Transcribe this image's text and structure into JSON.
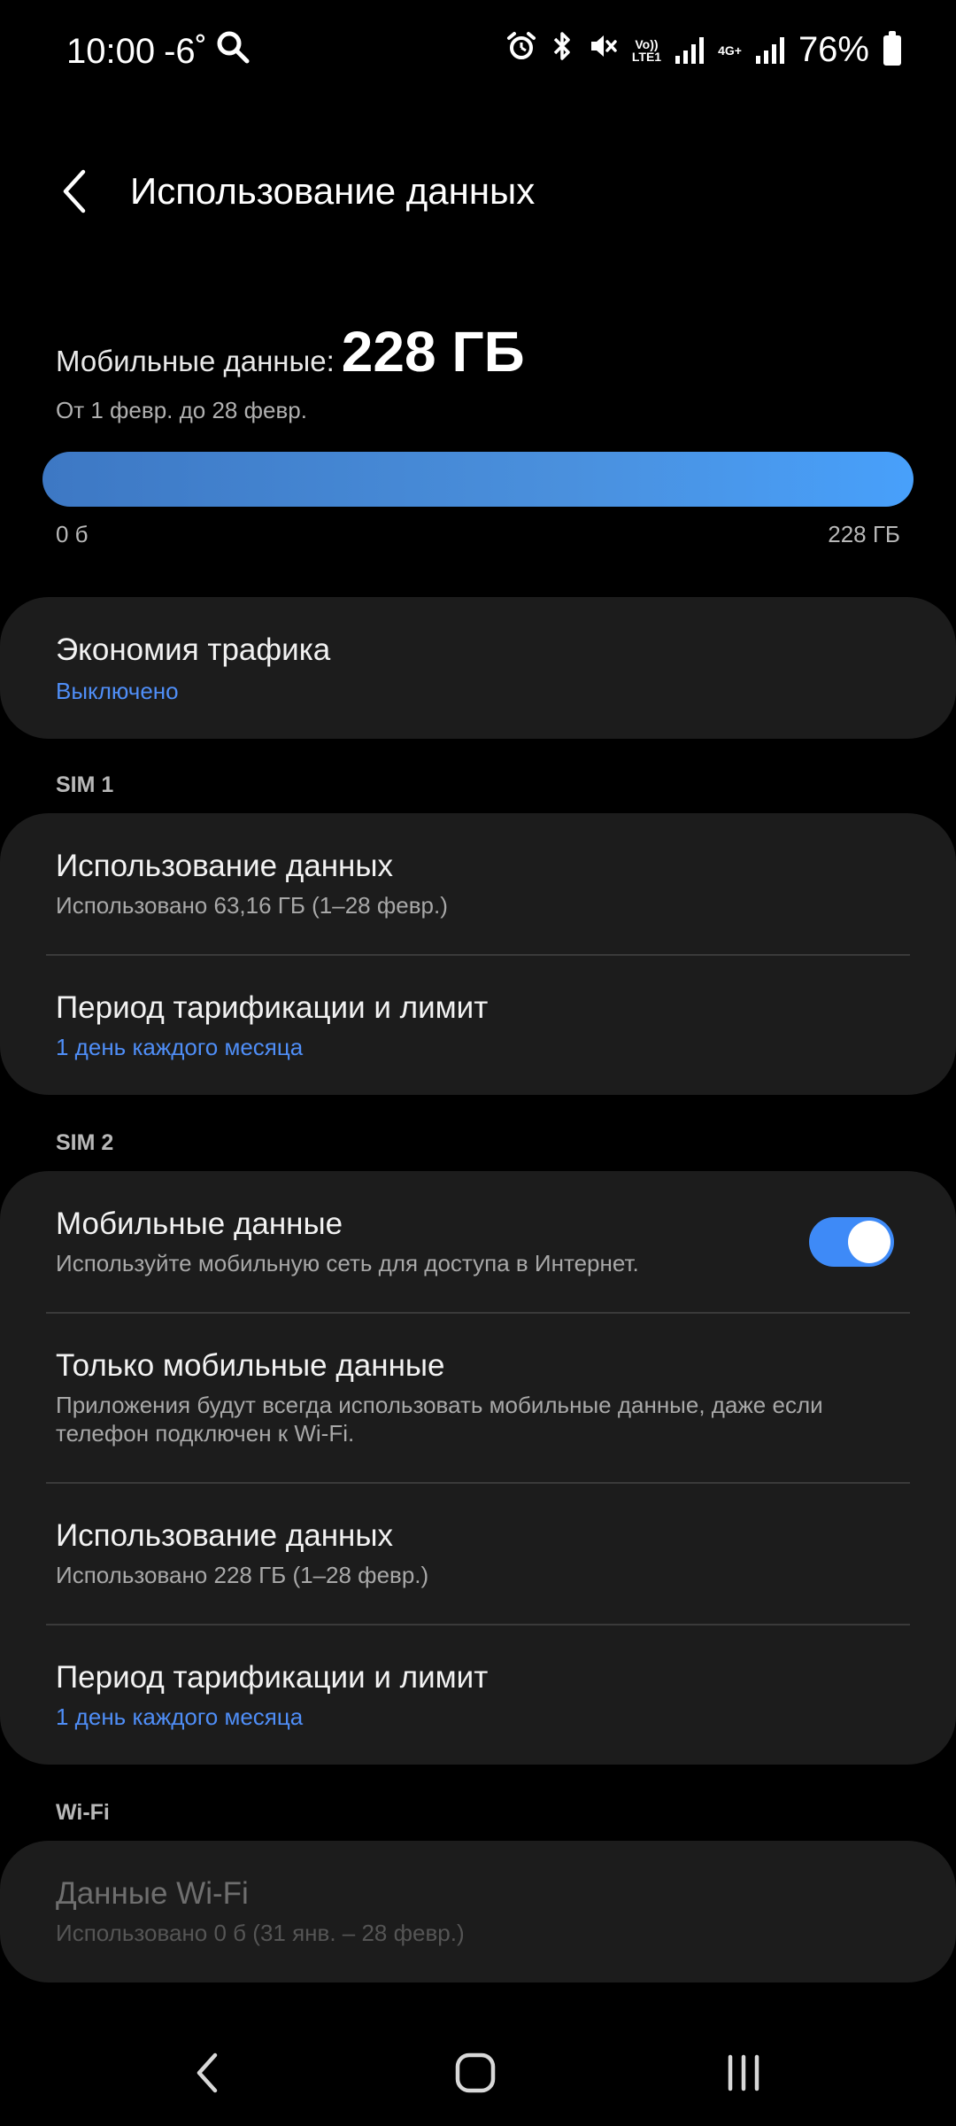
{
  "status_bar": {
    "time": "10:00",
    "temperature": "-6˚",
    "volte_label": "Vo))\nLTE1",
    "network_label": "4G+",
    "battery_percent": "76%"
  },
  "header": {
    "title": "Использование данных"
  },
  "summary": {
    "label": "Мобильные данные:",
    "value": "228 ГБ",
    "period": "От 1 февр. до 28 февр.",
    "bar_min": "0 б",
    "bar_max": "228 ГБ",
    "fill_fraction": 1.0
  },
  "traffic_saver": {
    "title": "Экономия трафика",
    "status": "Выключено"
  },
  "sim1": {
    "section_label": "SIM 1",
    "usage_title": "Использование данных",
    "usage_sub": "Использовано 63,16 ГБ (1–28 февр.)",
    "billing_title": "Период тарификации и лимит",
    "billing_sub": "1 день каждого месяца"
  },
  "sim2": {
    "section_label": "SIM 2",
    "mobile_data_title": "Мобильные данные",
    "mobile_data_sub": "Используйте мобильную сеть для доступа в Интернет.",
    "mobile_data_enabled": true,
    "only_mobile_title": "Только мобильные данные",
    "only_mobile_sub": "Приложения будут всегда использовать мобильные данные, даже если телефон подключен к Wi-Fi.",
    "usage_title": "Использование данных",
    "usage_sub": "Использовано 228 ГБ (1–28 февр.)",
    "billing_title": "Период тарификации и лимит",
    "billing_sub": "1 день каждого месяца"
  },
  "wifi": {
    "section_label": "Wi-Fi",
    "title": "Данные Wi-Fi",
    "sub": "Использовано 0 б (31 янв. – 28 февр.)"
  },
  "colors": {
    "accent": "#3e8af7",
    "link": "#4f8ef7",
    "card": "#1c1c1c"
  }
}
